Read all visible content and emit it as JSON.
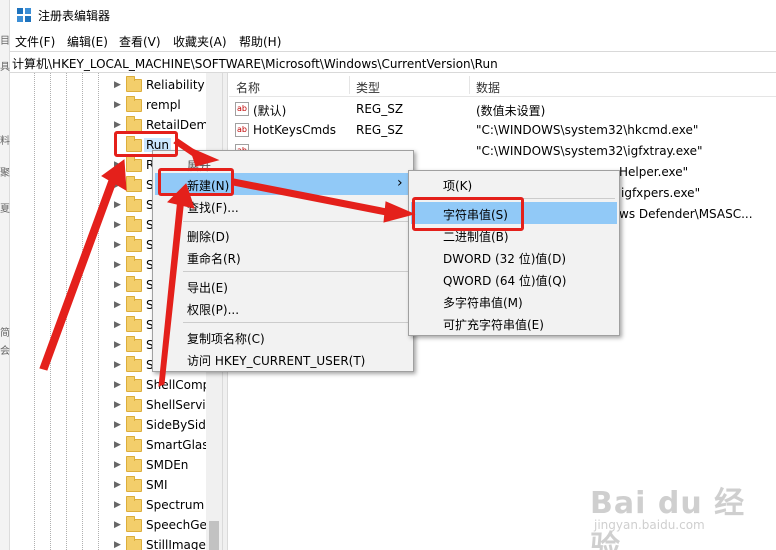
{
  "window": {
    "title": "注册表编辑器"
  },
  "left_strip_chars": [
    "目",
    "具",
    "料",
    "聚",
    "夏",
    "简",
    "会"
  ],
  "menubar": {
    "items": [
      "文件(F)",
      "编辑(E)",
      "查看(V)",
      "收藏夹(A)",
      "帮助(H)"
    ]
  },
  "address": {
    "path": "计算机\\HKEY_LOCAL_MACHINE\\SOFTWARE\\Microsoft\\Windows\\CurrentVersion\\Run"
  },
  "tree": {
    "items": [
      "Reliability",
      "rempl",
      "RetailDem",
      "Run",
      "R",
      "S",
      "S",
      "S",
      "S",
      "S",
      "S",
      "S",
      "S",
      "S",
      "S",
      "ShellComp",
      "ShellServic",
      "SideBySide",
      "SmartGlas",
      "SMDEn",
      "SMI",
      "Spectrum",
      "SpeechGe",
      "StillImage"
    ],
    "selected": "Run"
  },
  "list": {
    "headers": [
      "名称",
      "类型",
      "数据"
    ],
    "rows": [
      {
        "name": "(默认)",
        "type": "REG_SZ",
        "data": "(数值未设置)"
      },
      {
        "name": "HotKeysCmds",
        "type": "REG_SZ",
        "data": "\"C:\\WINDOWS\\system32\\hkcmd.exe\""
      },
      {
        "name": "",
        "type": "",
        "data": "\"C:\\WINDOWS\\system32\\igfxtray.exe\""
      },
      {
        "name": "",
        "type": "",
        "data": "Helper.exe\""
      },
      {
        "name": "",
        "type": "",
        "data": "igfxpers.exe\""
      },
      {
        "name": "",
        "type": "",
        "data": "ws Defender\\MSASC..."
      }
    ]
  },
  "context_menu": {
    "items": [
      "展开",
      "新建(N)",
      "查找(F)...",
      "删除(D)",
      "重命名(R)",
      "导出(E)",
      "权限(P)...",
      "复制项名称(C)",
      "访问 HKEY_CURRENT_USER(T)"
    ],
    "submenu_arrow": "›"
  },
  "submenu": {
    "items": [
      "项(K)",
      "字符串值(S)",
      "二进制值(B)",
      "DWORD (32 位)值(D)",
      "QWORD (64 位)值(Q)",
      "多字符串值(M)",
      "可扩充字符串值(E)"
    ]
  },
  "watermark": {
    "main": "Bai du 经验",
    "sub": "jingyan.baidu.com"
  },
  "colors": {
    "annotation_red": "#e4201b",
    "menu_highlight": "#91c9f7",
    "selection": "#cce8ff",
    "folder": "#f3ce6b"
  }
}
